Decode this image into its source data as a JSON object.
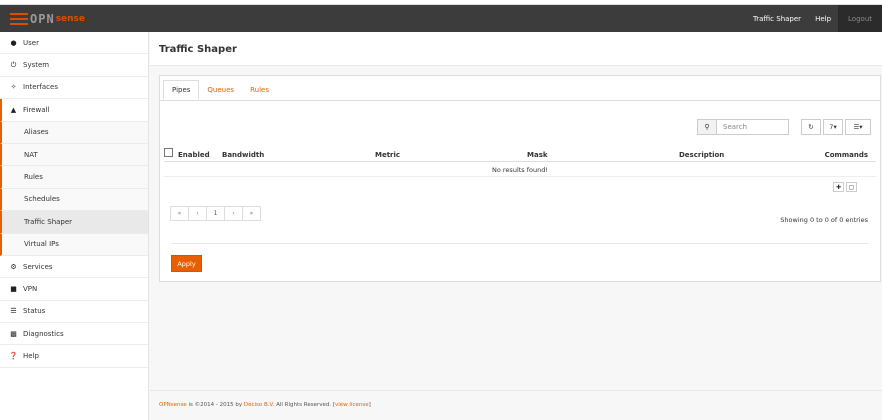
{
  "navbar": {
    "logo_prefix": "OPN",
    "logo_suffix": "sense",
    "links": [
      "Traffic Shaper",
      "Help"
    ],
    "logout": "Logout"
  },
  "sidebar": {
    "items": [
      {
        "label": "User",
        "icon": "user-icon"
      },
      {
        "label": "System",
        "icon": "power-icon"
      },
      {
        "label": "Interfaces",
        "icon": "wrench-icon"
      },
      {
        "label": "Firewall",
        "icon": "fire-icon"
      }
    ],
    "firewall_sub": [
      "Aliases",
      "NAT",
      "Rules",
      "Schedules",
      "Traffic Shaper",
      "Virtual IPs"
    ],
    "items_after": [
      {
        "label": "Services",
        "icon": "gear-icon"
      },
      {
        "label": "VPN",
        "icon": "lock-icon"
      },
      {
        "label": "Status",
        "icon": "list-icon"
      },
      {
        "label": "Diagnostics",
        "icon": "bar-chart-icon"
      },
      {
        "label": "Help",
        "icon": "question-icon"
      }
    ]
  },
  "page": {
    "title": "Traffic Shaper"
  },
  "tabs": [
    "Pipes",
    "Queues",
    "Rules"
  ],
  "search": {
    "placeholder": "Search"
  },
  "toolbar": {
    "page_size": "7"
  },
  "grid": {
    "columns": [
      "Enabled",
      "Bandwidth",
      "Metric",
      "Mask",
      "Description",
      "Commands"
    ],
    "empty_text": "No results found!",
    "pager": [
      "«",
      "‹",
      "1",
      "›",
      "»"
    ],
    "showing": "Showing 0 to 0 of 0 entries"
  },
  "apply_label": "Apply",
  "footer": {
    "org": "OPNsense",
    "text1": " is ©2014 - 2015 by ",
    "company": "Deciso B.V.",
    "text2": " All Rights Reserved. [",
    "license": "view license",
    "text3": "]"
  },
  "colors": {
    "accent": "#e95f00",
    "navbar": "#3c3c3c"
  }
}
